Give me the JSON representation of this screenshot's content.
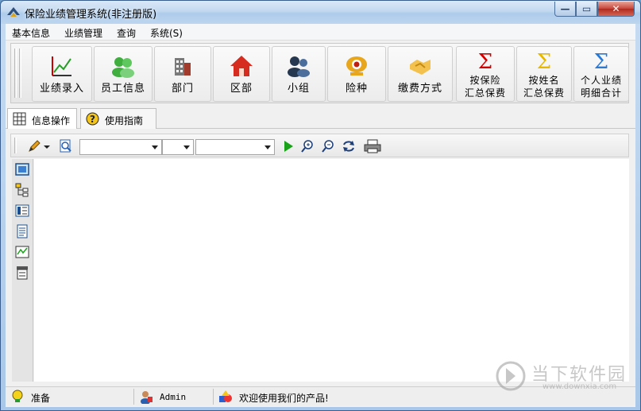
{
  "window": {
    "title": "保险业绩管理系统(非注册版)",
    "minimize": "—",
    "maximize": "▭",
    "close": "✕"
  },
  "menu": [
    "基本信息",
    "业绩管理",
    "查询",
    "系统(S)"
  ],
  "big_toolbar": [
    {
      "label": "业绩录入",
      "icon": "chart-line-icon"
    },
    {
      "label": "员工信息",
      "icon": "users-icon"
    },
    {
      "label": "部门",
      "icon": "building-icon"
    },
    {
      "label": "区部",
      "icon": "house-icon"
    },
    {
      "label": "小组",
      "icon": "group-icon"
    },
    {
      "label": "险种",
      "icon": "eye-icon"
    },
    {
      "label": "缴费方式",
      "icon": "handshake-icon"
    },
    {
      "line1": "按保险",
      "line2": "汇总保费",
      "sigma": "Σ",
      "color": "#d40000"
    },
    {
      "line1": "按姓名",
      "line2": "汇总保费",
      "sigma": "Σ",
      "color": "#e6b800"
    },
    {
      "line1": "个人业绩",
      "line2": "明细合计",
      "sigma": "Σ",
      "color": "#2a7ad4"
    }
  ],
  "tabs": [
    {
      "label": "信息操作",
      "icon": "grid-icon"
    },
    {
      "label": "使用指南",
      "icon": "help-icon"
    }
  ],
  "small_toolbar": {
    "combo1": "",
    "combo2": "",
    "combo3": ""
  },
  "status": {
    "state": "准备",
    "user": "Admin",
    "message": "欢迎使用我们的产品!"
  },
  "watermark": {
    "cn": "当下软件园",
    "en": "www.downxia.com"
  }
}
